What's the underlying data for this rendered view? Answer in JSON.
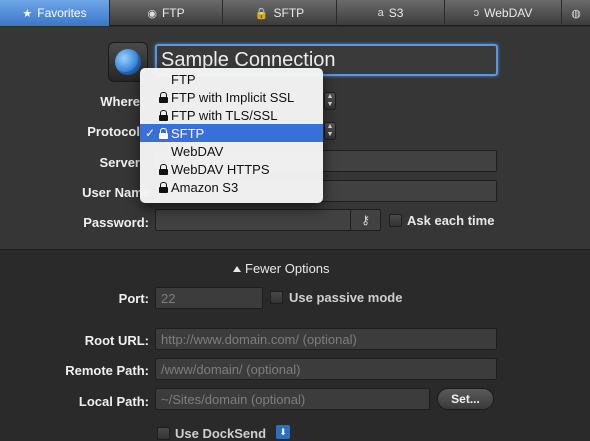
{
  "tabs": [
    {
      "label": "Favorites",
      "icon": "star-icon",
      "glyph": "★",
      "active": true
    },
    {
      "label": "FTP",
      "icon": "ftp-icon",
      "glyph": "◉"
    },
    {
      "label": "SFTP",
      "icon": "lock-icon",
      "glyph": "🔒"
    },
    {
      "label": "S3",
      "icon": "amazon-s3-icon",
      "glyph": "a"
    },
    {
      "label": "WebDAV",
      "icon": "webdav-icon",
      "glyph": "ↄ"
    },
    {
      "label": "",
      "icon": "network-icon",
      "glyph": "◍"
    }
  ],
  "connection": {
    "name": "Sample Connection",
    "icon": "globe-icon"
  },
  "labels": {
    "where": "Where",
    "protocol": "Protocol",
    "server": "Server",
    "user_name": "User Name",
    "password": "Password:"
  },
  "password": {
    "value": "",
    "key_icon": "key-icon",
    "ask_each_time": "Ask each time"
  },
  "protocol_menu": {
    "items": [
      {
        "label": "FTP",
        "lock": false,
        "selected": false
      },
      {
        "label": "FTP with Implicit SSL",
        "lock": true,
        "selected": false
      },
      {
        "label": "FTP with TLS/SSL",
        "lock": true,
        "selected": false
      },
      {
        "label": "SFTP",
        "lock": true,
        "selected": true
      },
      {
        "label": "WebDAV",
        "lock": false,
        "selected": false
      },
      {
        "label": "WebDAV HTTPS",
        "lock": true,
        "selected": false
      },
      {
        "label": "Amazon S3",
        "lock": true,
        "selected": false
      }
    ]
  },
  "options": {
    "toggle_label": "Fewer Options",
    "port_label": "Port:",
    "port_placeholder": "22",
    "passive_mode": "Use passive mode",
    "root_url_label": "Root URL:",
    "root_url_placeholder": "http://www.domain.com/ (optional)",
    "remote_path_label": "Remote Path:",
    "remote_path_placeholder": "/www/domain/ (optional)",
    "local_path_label": "Local Path:",
    "local_path_placeholder": "~/Sites/domain (optional)",
    "set_button": "Set...",
    "docksend_label": "Use DockSend"
  },
  "colors": {
    "accent": "#3a6fd8",
    "tab_active": "#4f8ad8",
    "background": "#2b2b2b"
  }
}
